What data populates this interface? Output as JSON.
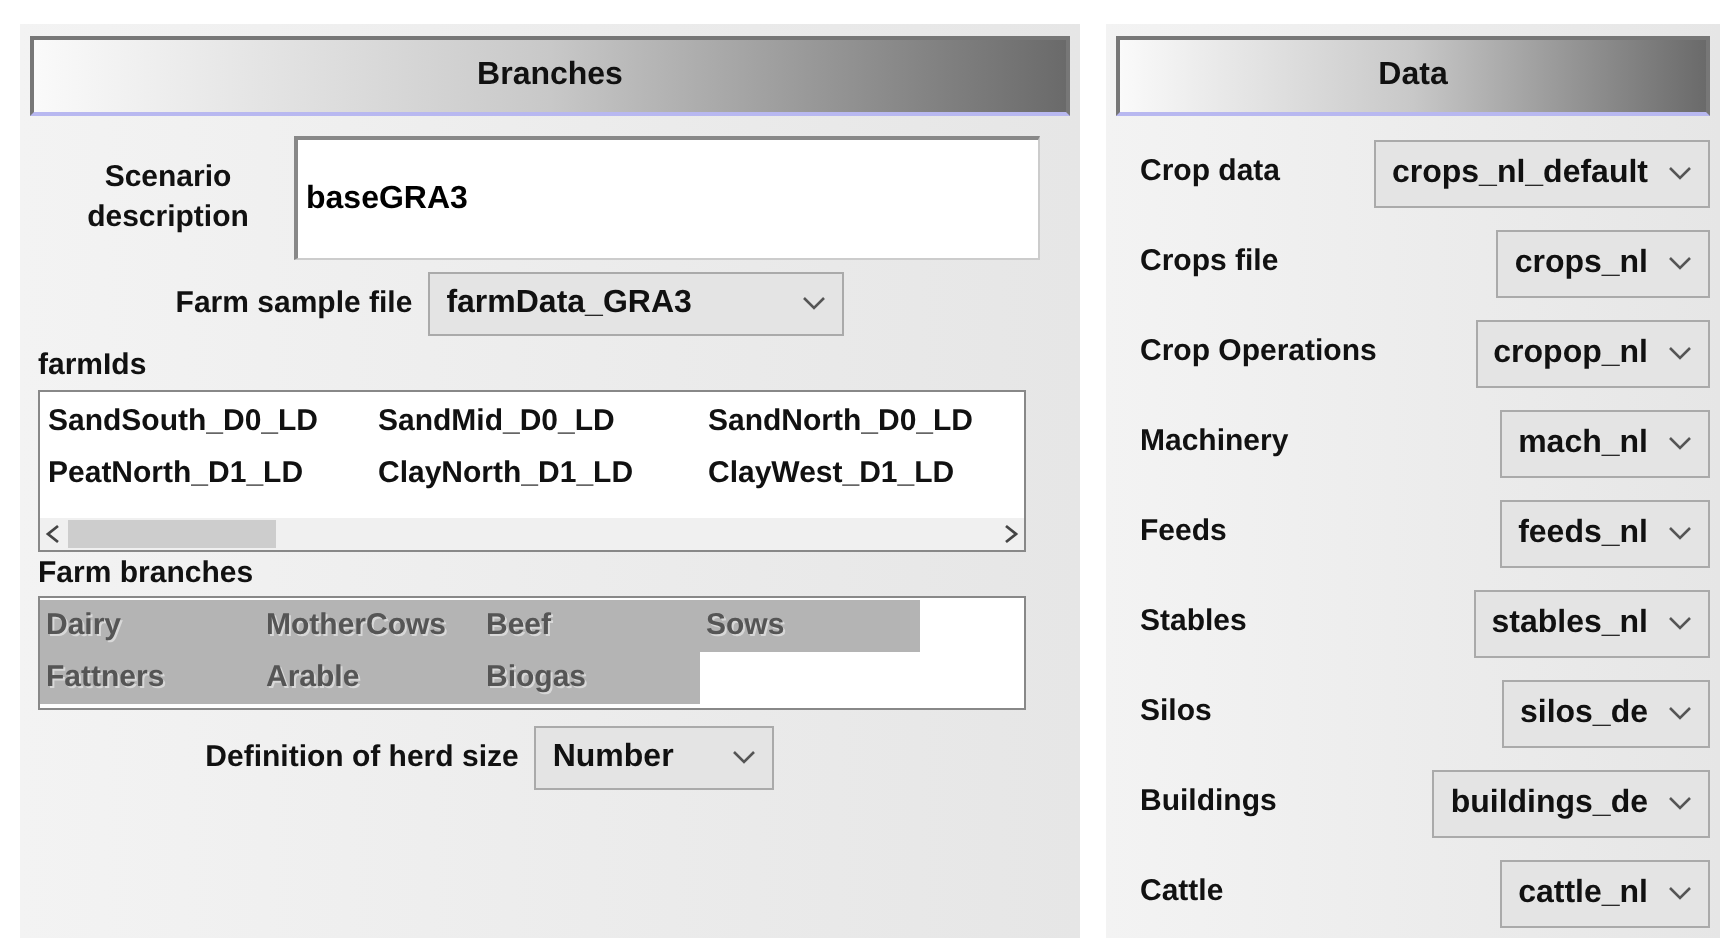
{
  "branches": {
    "title": "Branches",
    "scenario": {
      "label": "Scenario description",
      "value": "baseGRA3"
    },
    "farm_sample_file": {
      "label": "Farm sample file",
      "value": "farmData_GRA3"
    },
    "farm_ids": {
      "label": "farmIds",
      "items": [
        {
          "label": "SandSouth_D0_LD"
        },
        {
          "label": "SandMid_D0_LD"
        },
        {
          "label": "SandNorth_D0_LD"
        },
        {
          "label": "PeatNorth_D1_LD"
        },
        {
          "label": "ClayNorth_D1_LD"
        },
        {
          "label": "ClayWest_D1_LD"
        }
      ]
    },
    "farm_branches": {
      "label": "Farm branches",
      "disabled": true,
      "items": [
        {
          "label": "Dairy",
          "selected": true
        },
        {
          "label": "MotherCows",
          "selected": true
        },
        {
          "label": "Beef",
          "selected": true
        },
        {
          "label": "Sows",
          "selected": true
        },
        {
          "label": "Fattners",
          "selected": true
        },
        {
          "label": "Arable",
          "selected": true
        },
        {
          "label": "Biogas",
          "selected": true
        }
      ]
    },
    "herd_size": {
      "label": "Definition of herd size",
      "value": "Number"
    }
  },
  "data": {
    "title": "Data",
    "fields": [
      {
        "label": "Crop data",
        "value": "crops_nl_default"
      },
      {
        "label": "Crops file",
        "value": "crops_nl"
      },
      {
        "label": "Crop Operations",
        "value": "cropop_nl"
      },
      {
        "label": "Machinery",
        "value": "mach_nl"
      },
      {
        "label": "Feeds",
        "value": "feeds_nl"
      },
      {
        "label": "Stables",
        "value": "stables_nl"
      },
      {
        "label": "Silos",
        "value": "silos_de"
      },
      {
        "label": "Buildings",
        "value": "buildings_de"
      },
      {
        "label": "Cattle",
        "value": "cattle_nl"
      }
    ]
  }
}
